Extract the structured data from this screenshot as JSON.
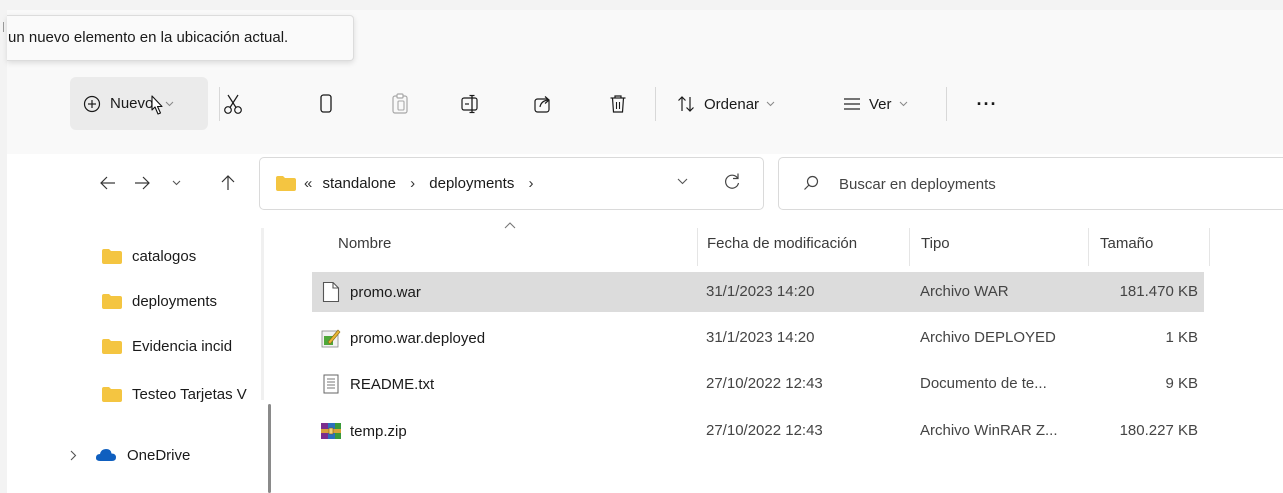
{
  "tooltip": {
    "text": "un nuevo elemento en la ubicación actual."
  },
  "toolbar": {
    "new_label": "Nuevo",
    "sort_label": "Ordenar",
    "view_label": "Ver",
    "more_label": "···",
    "icons": [
      "plus-circle-icon",
      "scissors-icon",
      "copy-icon",
      "paste-icon",
      "rename-icon",
      "share-icon",
      "trash-icon",
      "sort-icon",
      "view-icon",
      "more-icon"
    ]
  },
  "address": {
    "overflow": "«",
    "crumbs": [
      "standalone",
      "deployments"
    ],
    "separator": "›"
  },
  "search": {
    "placeholder": "Buscar en deployments"
  },
  "nav": {
    "items": [
      {
        "label": "catalogos"
      },
      {
        "label": "deployments"
      },
      {
        "label": "Evidencia incid"
      },
      {
        "label": "Testeo Tarjetas V"
      }
    ],
    "onedrive": "OneDrive"
  },
  "columns": {
    "name": "Nombre",
    "date": "Fecha de modificación",
    "type": "Tipo",
    "size": "Tamaño"
  },
  "files": [
    {
      "name": "promo.war",
      "date": "31/1/2023 14:20",
      "type": "Archivo WAR",
      "size": "181.470 KB",
      "icon": "blank-file-icon",
      "selected": true
    },
    {
      "name": "promo.war.deployed",
      "date": "31/1/2023 14:20",
      "type": "Archivo DEPLOYED",
      "size": "1 KB",
      "icon": "deployed-file-icon",
      "selected": false
    },
    {
      "name": "README.txt",
      "date": "27/10/2022 12:43",
      "type": "Documento de te...",
      "size": "9 KB",
      "icon": "text-file-icon",
      "selected": false
    },
    {
      "name": "temp.zip",
      "date": "27/10/2022 12:43",
      "type": "Archivo WinRAR Z...",
      "size": "180.227 KB",
      "icon": "winrar-icon",
      "selected": false
    }
  ],
  "colors": {
    "folder": "#f4c541",
    "selection": "#dcdcdc",
    "onedrive": "#0f5fbf"
  }
}
